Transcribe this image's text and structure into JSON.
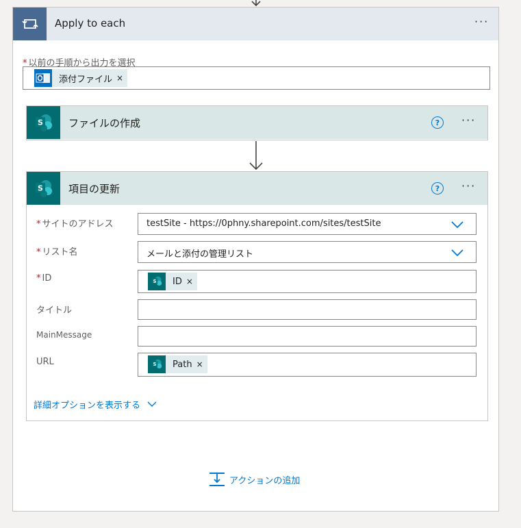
{
  "loop": {
    "title": "Apply to each",
    "more_label": "···",
    "select_label": "以前の手順から出力を選択",
    "token": {
      "label": "添付ファイル",
      "remove": "×",
      "icon": "outlook-icon"
    }
  },
  "create_file": {
    "title": "ファイルの作成",
    "help": "?",
    "more_label": "···",
    "icon": "sharepoint-icon"
  },
  "update_item": {
    "title": "項目の更新",
    "help": "?",
    "more_label": "···",
    "icon": "sharepoint-icon",
    "fields": {
      "site": {
        "label": "サイトのアドレス",
        "value": "testSite - https://0phny.sharepoint.com/sites/testSite",
        "required": true
      },
      "list": {
        "label": "リスト名",
        "value": "メールと添付の管理リスト",
        "required": true
      },
      "id": {
        "label": "ID",
        "token": "ID",
        "remove": "×",
        "required": true
      },
      "title": {
        "label": "タイトル",
        "value": ""
      },
      "main_message": {
        "label": "MainMessage",
        "value": ""
      },
      "url": {
        "label": "URL",
        "token": "Path",
        "remove": "×"
      }
    },
    "advanced_link": "詳細オプションを表示する"
  },
  "add_action": {
    "label": "アクションの追加"
  },
  "colors": {
    "loop_header": "#486991",
    "sharepoint": "#036c70",
    "card_header_bg": "#d9e7e6",
    "link": "#0078d4",
    "required": "#a4262c"
  }
}
